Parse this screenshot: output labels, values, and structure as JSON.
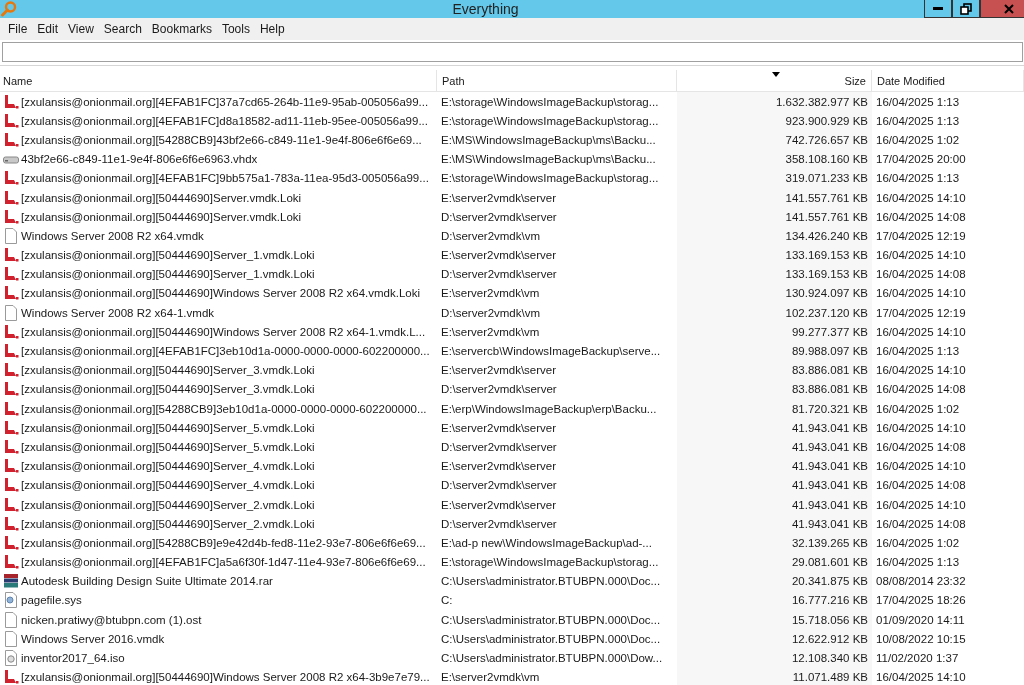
{
  "window": {
    "title": "Everything"
  },
  "menu": [
    "File",
    "Edit",
    "View",
    "Search",
    "Bookmarks",
    "Tools",
    "Help"
  ],
  "columns": [
    {
      "label": "Name",
      "sorted": false
    },
    {
      "label": "Path",
      "sorted": false
    },
    {
      "label": "Size",
      "sorted": true
    },
    {
      "label": "Date Modified",
      "sorted": false
    }
  ],
  "rows": [
    {
      "kind": "loki",
      "name": "[zxulansis@onionmail.org][4EFAB1FC]37a7cd65-264b-11e9-95ab-005056a99...",
      "path": "E:\\storage\\WindowsImageBackup\\storag...",
      "size": "1.632.382.977 KB",
      "date": "16/04/2025 1:13"
    },
    {
      "kind": "loki",
      "name": "[zxulansis@onionmail.org][4EFAB1FC]d8a18582-ad11-11eb-95ee-005056a99...",
      "path": "E:\\storage\\WindowsImageBackup\\storag...",
      "size": "923.900.929 KB",
      "date": "16/04/2025 1:13"
    },
    {
      "kind": "loki",
      "name": "[zxulansis@onionmail.org][54288CB9]43bf2e66-c849-11e1-9e4f-806e6f6e69...",
      "path": "E:\\MS\\WindowsImageBackup\\ms\\Backu...",
      "size": "742.726.657 KB",
      "date": "16/04/2025 1:02"
    },
    {
      "kind": "disk",
      "name": "43bf2e66-c849-11e1-9e4f-806e6f6e6963.vhdx",
      "path": "E:\\MS\\WindowsImageBackup\\ms\\Backu...",
      "size": "358.108.160 KB",
      "date": "17/04/2025 20:00"
    },
    {
      "kind": "loki",
      "name": "[zxulansis@onionmail.org][4EFAB1FC]9bb575a1-783a-11ea-95d3-005056a99...",
      "path": "E:\\storage\\WindowsImageBackup\\storag...",
      "size": "319.071.233 KB",
      "date": "16/04/2025 1:13"
    },
    {
      "kind": "loki",
      "name": "[zxulansis@onionmail.org][50444690]Server.vmdk.Loki",
      "path": "E:\\server2vmdk\\server",
      "size": "141.557.761 KB",
      "date": "16/04/2025 14:10"
    },
    {
      "kind": "loki",
      "name": "[zxulansis@onionmail.org][50444690]Server.vmdk.Loki",
      "path": "D:\\server2vmdk\\server",
      "size": "141.557.761 KB",
      "date": "16/04/2025 14:08"
    },
    {
      "kind": "file",
      "name": "Windows Server 2008 R2 x64.vmdk",
      "path": "D:\\server2vmdk\\vm",
      "size": "134.426.240 KB",
      "date": "17/04/2025 12:19"
    },
    {
      "kind": "loki",
      "name": "[zxulansis@onionmail.org][50444690]Server_1.vmdk.Loki",
      "path": "E:\\server2vmdk\\server",
      "size": "133.169.153 KB",
      "date": "16/04/2025 14:10"
    },
    {
      "kind": "loki",
      "name": "[zxulansis@onionmail.org][50444690]Server_1.vmdk.Loki",
      "path": "D:\\server2vmdk\\server",
      "size": "133.169.153 KB",
      "date": "16/04/2025 14:08"
    },
    {
      "kind": "loki",
      "name": "[zxulansis@onionmail.org][50444690]Windows Server 2008 R2 x64.vmdk.Loki",
      "path": "E:\\server2vmdk\\vm",
      "size": "130.924.097 KB",
      "date": "16/04/2025 14:10"
    },
    {
      "kind": "file",
      "name": "Windows Server 2008 R2 x64-1.vmdk",
      "path": "D:\\server2vmdk\\vm",
      "size": "102.237.120 KB",
      "date": "17/04/2025 12:19"
    },
    {
      "kind": "loki",
      "name": "[zxulansis@onionmail.org][50444690]Windows Server 2008 R2 x64-1.vmdk.L...",
      "path": "E:\\server2vmdk\\vm",
      "size": "99.277.377 KB",
      "date": "16/04/2025 14:10"
    },
    {
      "kind": "loki",
      "name": "[zxulansis@onionmail.org][4EFAB1FC]3eb10d1a-0000-0000-0000-602200000...",
      "path": "E:\\servercb\\WindowsImageBackup\\serve...",
      "size": "89.988.097 KB",
      "date": "16/04/2025 1:13"
    },
    {
      "kind": "loki",
      "name": "[zxulansis@onionmail.org][50444690]Server_3.vmdk.Loki",
      "path": "E:\\server2vmdk\\server",
      "size": "83.886.081 KB",
      "date": "16/04/2025 14:10"
    },
    {
      "kind": "loki",
      "name": "[zxulansis@onionmail.org][50444690]Server_3.vmdk.Loki",
      "path": "D:\\server2vmdk\\server",
      "size": "83.886.081 KB",
      "date": "16/04/2025 14:08"
    },
    {
      "kind": "loki",
      "name": "[zxulansis@onionmail.org][54288CB9]3eb10d1a-0000-0000-0000-602200000...",
      "path": "E:\\erp\\WindowsImageBackup\\erp\\Backu...",
      "size": "81.720.321 KB",
      "date": "16/04/2025 1:02"
    },
    {
      "kind": "loki",
      "name": "[zxulansis@onionmail.org][50444690]Server_5.vmdk.Loki",
      "path": "E:\\server2vmdk\\server",
      "size": "41.943.041 KB",
      "date": "16/04/2025 14:10"
    },
    {
      "kind": "loki",
      "name": "[zxulansis@onionmail.org][50444690]Server_5.vmdk.Loki",
      "path": "D:\\server2vmdk\\server",
      "size": "41.943.041 KB",
      "date": "16/04/2025 14:08"
    },
    {
      "kind": "loki",
      "name": "[zxulansis@onionmail.org][50444690]Server_4.vmdk.Loki",
      "path": "E:\\server2vmdk\\server",
      "size": "41.943.041 KB",
      "date": "16/04/2025 14:10"
    },
    {
      "kind": "loki",
      "name": "[zxulansis@onionmail.org][50444690]Server_4.vmdk.Loki",
      "path": "D:\\server2vmdk\\server",
      "size": "41.943.041 KB",
      "date": "16/04/2025 14:08"
    },
    {
      "kind": "loki",
      "name": "[zxulansis@onionmail.org][50444690]Server_2.vmdk.Loki",
      "path": "E:\\server2vmdk\\server",
      "size": "41.943.041 KB",
      "date": "16/04/2025 14:10"
    },
    {
      "kind": "loki",
      "name": "[zxulansis@onionmail.org][50444690]Server_2.vmdk.Loki",
      "path": "D:\\server2vmdk\\server",
      "size": "41.943.041 KB",
      "date": "16/04/2025 14:08"
    },
    {
      "kind": "loki",
      "name": "[zxulansis@onionmail.org][54288CB9]e9e42d4b-fed8-11e2-93e7-806e6f6e69...",
      "path": "E:\\ad-p new\\WindowsImageBackup\\ad-...",
      "size": "32.139.265 KB",
      "date": "16/04/2025 1:02"
    },
    {
      "kind": "loki",
      "name": "[zxulansis@onionmail.org][4EFAB1FC]a5a6f30f-1d47-11e4-93e7-806e6f6e69...",
      "path": "E:\\storage\\WindowsImageBackup\\storag...",
      "size": "29.081.601 KB",
      "date": "16/04/2025 1:13"
    },
    {
      "kind": "archive",
      "name": "Autodesk Building Design Suite Ultimate 2014.rar",
      "path": "C:\\Users\\administrator.BTUBPN.000\\Doc...",
      "size": "20.341.875 KB",
      "date": "08/08/2014 23:32"
    },
    {
      "kind": "system",
      "name": "pagefile.sys",
      "path": "C:",
      "size": "16.777.216 KB",
      "date": "17/04/2025 18:26"
    },
    {
      "kind": "file",
      "name": "nicken.pratiwy@btubpn.com (1).ost",
      "path": "C:\\Users\\administrator.BTUBPN.000\\Doc...",
      "size": "15.718.056 KB",
      "date": "01/09/2020 14:11"
    },
    {
      "kind": "file",
      "name": "Windows Server 2016.vmdk",
      "path": "C:\\Users\\administrator.BTUBPN.000\\Doc...",
      "size": "12.622.912 KB",
      "date": "10/08/2022 10:15"
    },
    {
      "kind": "disc",
      "name": "inventor2017_64.iso",
      "path": "C:\\Users\\administrator.BTUBPN.000\\Dow...",
      "size": "12.108.340 KB",
      "date": "11/02/2020 1:37"
    },
    {
      "kind": "loki",
      "name": "[zxulansis@onionmail.org][50444690]Windows Server 2008 R2 x64-3b9e7e79...",
      "path": "E:\\server2vmdk\\vm",
      "size": "11.071.489 KB",
      "date": "16/04/2025 14:10"
    }
  ]
}
